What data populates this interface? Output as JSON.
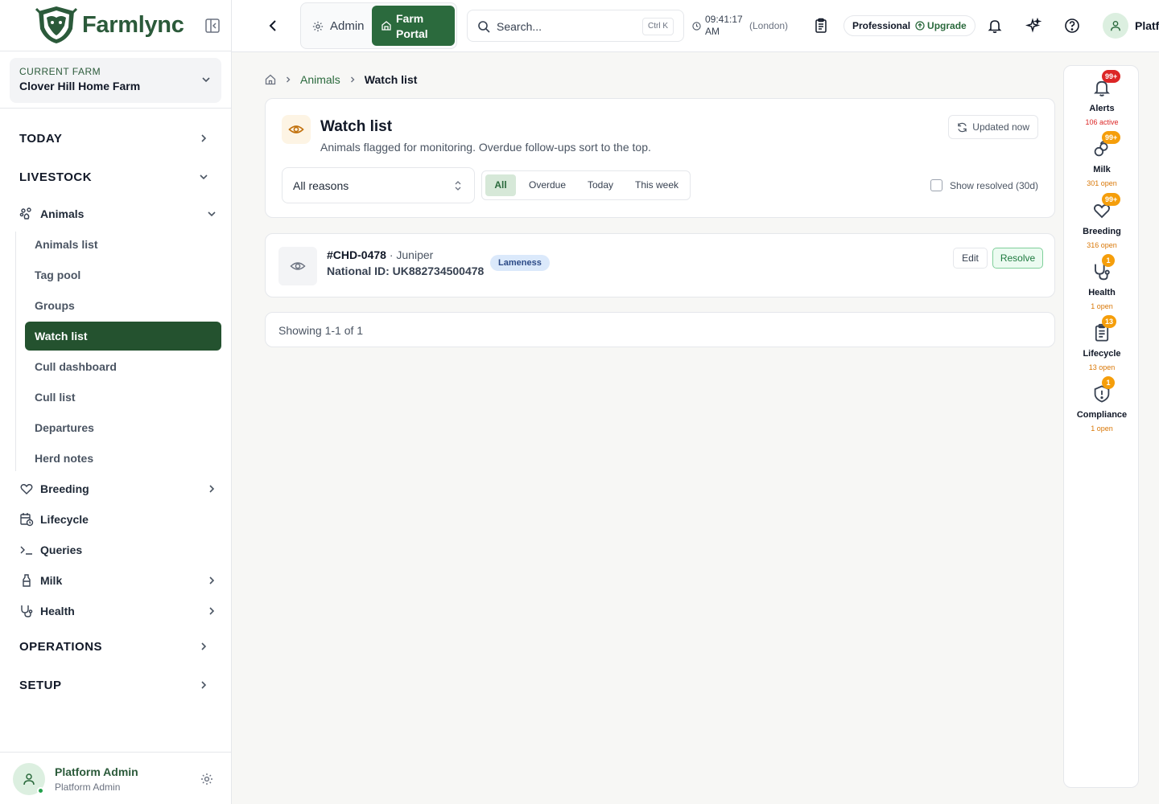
{
  "brand": {
    "name": "Farmlync"
  },
  "farm": {
    "label": "CURRENT FARM",
    "name": "Clover Hill Home Farm"
  },
  "sidebar": {
    "sections": {
      "today": "TODAY",
      "livestock": "LIVESTOCK",
      "operations": "OPERATIONS",
      "setup": "SETUP"
    },
    "animals": "Animals",
    "sub_items": [
      "Animals list",
      "Tag pool",
      "Groups",
      "Watch list",
      "Cull dashboard",
      "Cull list",
      "Departures",
      "Herd notes"
    ],
    "nav": {
      "breeding": "Breeding",
      "lifecycle": "Lifecycle",
      "queries": "Queries",
      "milk": "Milk",
      "health": "Health"
    }
  },
  "user": {
    "name": "Platform Admin",
    "role": "Platform Admin"
  },
  "topbar": {
    "admin": "Admin",
    "farm_portal": "Farm Portal",
    "search_placeholder": "Search...",
    "search_shortcut": "Ctrl K",
    "time": "09:41:17 AM",
    "timezone": "(London)",
    "plan": "Professional",
    "upgrade": "Upgrade",
    "user_short": "Platf"
  },
  "breadcrumb": {
    "parent": "Animals",
    "current": "Watch list"
  },
  "header": {
    "title": "Watch list",
    "subtitle": "Animals flagged for monitoring. Overdue follow-ups sort to the top.",
    "updated": "Updated now"
  },
  "filters": {
    "reason": "All reasons",
    "tabs": [
      "All",
      "Overdue",
      "Today",
      "This week"
    ],
    "active_tab": "All",
    "show_resolved": "Show resolved (30d)",
    "show_resolved_checked": false
  },
  "rows": [
    {
      "tag": "#CHD-0478",
      "separator": "·",
      "name": "Juniper",
      "national_id": "National ID: UK882734500478",
      "reason": "Lameness",
      "edit": "Edit",
      "resolve": "Resolve"
    }
  ],
  "pagination": {
    "text": "Showing 1-1 of 1"
  },
  "rail": [
    {
      "label": "Alerts",
      "badge": "99+",
      "status": "106 active",
      "badge_color": "#dc2626",
      "status_color": "#dc2626",
      "icon": "bell-icon"
    },
    {
      "label": "Milk",
      "badge": "99+",
      "status": "301 open",
      "badge_color": "#f59e0b",
      "status_color": "#d97706",
      "icon": "milk-icon"
    },
    {
      "label": "Breeding",
      "badge": "99+",
      "status": "316 open",
      "badge_color": "#f59e0b",
      "status_color": "#d97706",
      "icon": "heart-icon"
    },
    {
      "label": "Health",
      "badge": "1",
      "status": "1 open",
      "badge_color": "#f59e0b",
      "status_color": "#d97706",
      "icon": "stethoscope-icon"
    },
    {
      "label": "Lifecycle",
      "badge": "13",
      "status": "13 open",
      "badge_color": "#f59e0b",
      "status_color": "#d97706",
      "icon": "clipboard-icon"
    },
    {
      "label": "Compliance",
      "badge": "1",
      "status": "1 open",
      "badge_color": "#f59e0b",
      "status_color": "#d97706",
      "icon": "shield-icon"
    }
  ],
  "colors": {
    "brand": "#2b6a3d",
    "active_nav": "#24522f",
    "badge_blue": "#dbe9fb"
  }
}
